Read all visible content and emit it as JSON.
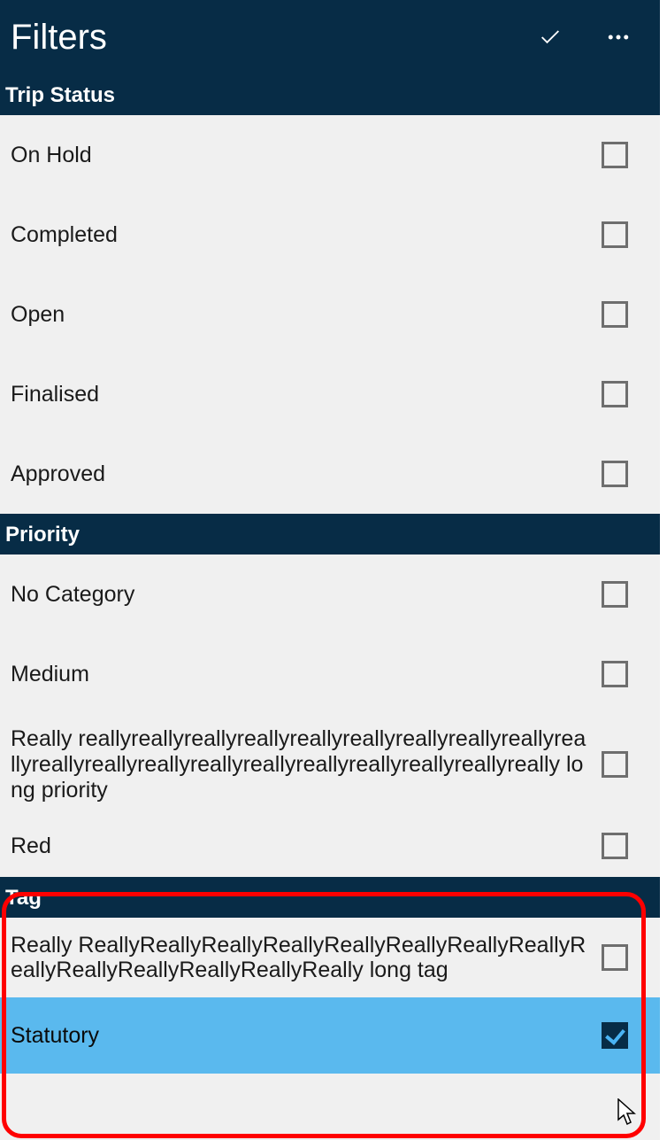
{
  "header": {
    "title": "Filters"
  },
  "sections": {
    "tripStatus": {
      "title": "Trip Status",
      "items": [
        {
          "label": "On Hold",
          "checked": false
        },
        {
          "label": "Completed",
          "checked": false
        },
        {
          "label": "Open",
          "checked": false
        },
        {
          "label": "Finalised",
          "checked": false
        },
        {
          "label": "Approved",
          "checked": false
        }
      ]
    },
    "priority": {
      "title": "Priority",
      "items": [
        {
          "label": "No Category",
          "checked": false
        },
        {
          "label": "Medium",
          "checked": false
        },
        {
          "label": "Really reallyreallyreallyreallyreallyreallyreallyreallyreallyreallyreallyreallyreallyreallyreallyreallyreallyreallyreallyreally long priority",
          "checked": false
        },
        {
          "label": "Red",
          "checked": false
        }
      ]
    },
    "tag": {
      "title": "Tag",
      "items": [
        {
          "label": "Really ReallyReallyReallyReallyReallyReallyReallyReallyReallyReallyReallyReallyReallyReally long tag",
          "checked": false
        },
        {
          "label": "Statutory",
          "checked": true,
          "selected": true
        }
      ]
    }
  }
}
